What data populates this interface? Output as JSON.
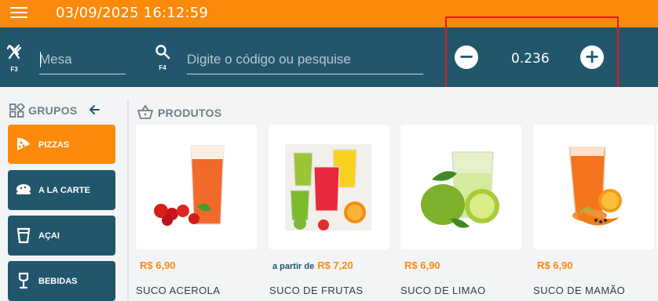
{
  "topbar": {
    "datetime": "03/09/2025 16:12:59",
    "menu_icon": "hamburger-icon"
  },
  "search": {
    "table_shortcut": "F3",
    "table_placeholder": "Mesa",
    "product_shortcut": "F4",
    "product_placeholder": "Digite o código ou pesquise"
  },
  "quantity": {
    "value": "0.236",
    "minus": "−",
    "plus": "+"
  },
  "groups": {
    "title": "GRUPOS",
    "items": [
      {
        "label": "PIZZAS",
        "icon": "pizza-icon",
        "active": true
      },
      {
        "label": "A LA CARTE",
        "icon": "dish-icon",
        "active": false
      },
      {
        "label": "AÇAI",
        "icon": "cup-icon",
        "active": false
      },
      {
        "label": "BEBIDAS",
        "icon": "wine-glass-icon",
        "active": false
      }
    ]
  },
  "products": {
    "title": "PRODUTOS",
    "items": [
      {
        "name": "SUCO ACEROLA",
        "prefix": "",
        "price": "R$ 6,90",
        "image": "acerola-juice"
      },
      {
        "name": "SUCO DE FRUTAS",
        "prefix": "a partir de",
        "price": "R$ 7,20",
        "image": "fruit-juices"
      },
      {
        "name": "SUCO DE LIMAO",
        "prefix": "",
        "price": "R$ 6,90",
        "image": "lime-juice"
      },
      {
        "name": "SUCO DE MAMÃO",
        "prefix": "",
        "price": "R$ 6,90",
        "image": "papaya-juice"
      }
    ]
  },
  "colors": {
    "header": "#fb8a0c",
    "bar": "#22566d",
    "accent": "#fb8a0c",
    "highlight_box": "#e31b1b"
  }
}
